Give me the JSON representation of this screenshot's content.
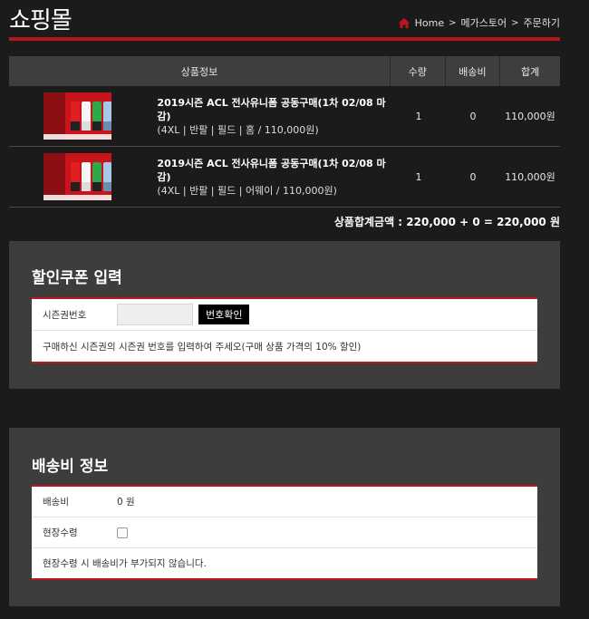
{
  "header": {
    "title": "쇼핑몰",
    "breadcrumb": [
      "Home",
      "메가스토어",
      "주문하기"
    ]
  },
  "colors": {
    "accent": "#b4161b",
    "background": "#1b1b1b",
    "panel": "#3d3d3d"
  },
  "cart": {
    "columns": {
      "info": "상품정보",
      "qty": "수량",
      "shipping": "배송비",
      "total": "합계"
    },
    "items": [
      {
        "name": "2019시즌 ACL 전사유니폼 공동구매(1차 02/08 마감)",
        "options": "(4XL | 반팔 | 필드 | 홈 / 110,000원)",
        "qty": "1",
        "shipping": "0",
        "total": "110,000원"
      },
      {
        "name": "2019시즌 ACL 전사유니폼 공동구매(1차 02/08 마감)",
        "options": "(4XL | 반팔 | 필드 | 어웨이 / 110,000원)",
        "qty": "1",
        "shipping": "0",
        "total": "110,000원"
      }
    ],
    "summary": "상품합계금액 : 220,000 + 0 = 220,000 원"
  },
  "coupon": {
    "title": "할인쿠폰 입력",
    "label": "시즌권번호",
    "input_value": "",
    "button": "번호확인",
    "note": "구매하신 시즌권의 시즌권 번호를 입력하여 주세오(구매 상품 가격의 10% 할인)"
  },
  "shipping": {
    "title": "배송비 정보",
    "fee_label": "배송비",
    "fee_value": "0 원",
    "pickup_label": "현장수령",
    "pickup_checked": false,
    "note": "현장수령 시 배송비가 부가되지 않습니다."
  }
}
